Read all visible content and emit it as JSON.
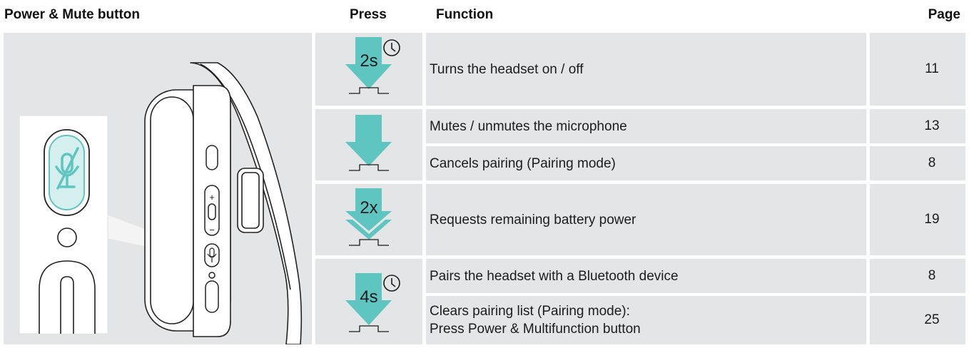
{
  "headers": {
    "title": "Power & Mute button",
    "press": "Press",
    "function": "Function",
    "page": "Page"
  },
  "colors": {
    "accent": "#5fc5c0",
    "background": "#e4e5e6"
  },
  "rows": [
    {
      "press": {
        "label": "2s",
        "icon": "clock-icon"
      },
      "functions": [
        {
          "text": "Turns the headset on / off",
          "page": "11"
        }
      ]
    },
    {
      "press": {
        "label": "",
        "icon": ""
      },
      "functions": [
        {
          "text": "Mutes / unmutes the microphone",
          "page": "13"
        },
        {
          "text": "Cancels pairing (Pairing mode)",
          "page": "8"
        }
      ]
    },
    {
      "press": {
        "label": "2x",
        "icon": ""
      },
      "functions": [
        {
          "text": "Requests remaining battery power",
          "page": "19"
        }
      ]
    },
    {
      "press": {
        "label": "4s",
        "icon": "clock-icon"
      },
      "functions": [
        {
          "text": "Pairs the headset with a Bluetooth device",
          "page": "8"
        },
        {
          "lines": [
            "Clears pairing list (Pairing mode):",
            "Press Power & Multifunction button"
          ],
          "page": "25"
        }
      ]
    }
  ]
}
